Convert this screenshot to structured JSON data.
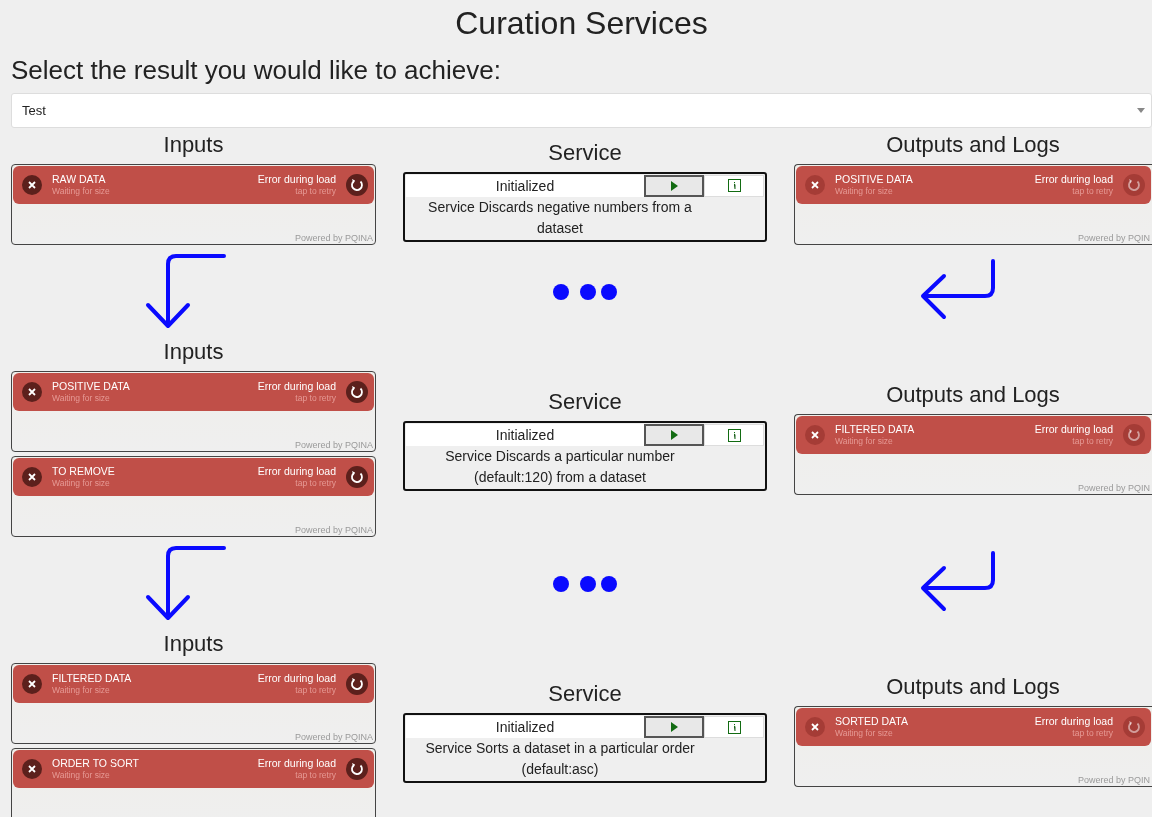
{
  "title": "Curation Services",
  "prompt": "Select the result you would like to achieve:",
  "result_select": {
    "value": "Test"
  },
  "stages": [
    {
      "inputs_heading": "Inputs",
      "inputs": [
        {
          "name": "RAW DATA",
          "status": "Waiting for size",
          "error": "Error during load",
          "retry": "tap to retry",
          "credit": "Powered by PQINA",
          "disabled": false
        }
      ],
      "service_heading": "Service",
      "service": {
        "status": "Initialized",
        "description": "Service Discards negative numbers from a dataset"
      },
      "outputs_heading": "Outputs and Logs",
      "outputs": [
        {
          "name": "POSITIVE DATA",
          "status": "Waiting for size",
          "error": "Error during load",
          "retry": "tap to retry",
          "credit": "Powered by PQIN",
          "disabled": true
        }
      ]
    },
    {
      "inputs_heading": "Inputs",
      "inputs": [
        {
          "name": "POSITIVE DATA",
          "status": "Waiting for size",
          "error": "Error during load",
          "retry": "tap to retry",
          "credit": "Powered by PQINA",
          "disabled": false
        },
        {
          "name": "TO REMOVE",
          "status": "Waiting for size",
          "error": "Error during load",
          "retry": "tap to retry",
          "credit": "Powered by PQINA",
          "disabled": false
        }
      ],
      "service_heading": "Service",
      "service": {
        "status": "Initialized",
        "description": "Service Discards a particular number (default:120) from a dataset"
      },
      "outputs_heading": "Outputs and Logs",
      "outputs": [
        {
          "name": "FILTERED DATA",
          "status": "Waiting for size",
          "error": "Error during load",
          "retry": "tap to retry",
          "credit": "Powered by PQIN",
          "disabled": true
        }
      ]
    },
    {
      "inputs_heading": "Inputs",
      "inputs": [
        {
          "name": "FILTERED DATA",
          "status": "Waiting for size",
          "error": "Error during load",
          "retry": "tap to retry",
          "credit": "Powered by PQINA",
          "disabled": false
        },
        {
          "name": "ORDER TO SORT",
          "status": "Waiting for size",
          "error": "Error during load",
          "retry": "tap to retry",
          "disabled": false
        }
      ],
      "service_heading": "Service",
      "service": {
        "status": "Initialized",
        "description": "Service Sorts a dataset in a particular order (default:asc)"
      },
      "outputs_heading": "Outputs and Logs",
      "outputs": [
        {
          "name": "SORTED DATA",
          "status": "Waiting for size",
          "error": "Error during load",
          "retry": "tap to retry",
          "credit": "Powered by PQIN",
          "disabled": true
        }
      ]
    }
  ]
}
